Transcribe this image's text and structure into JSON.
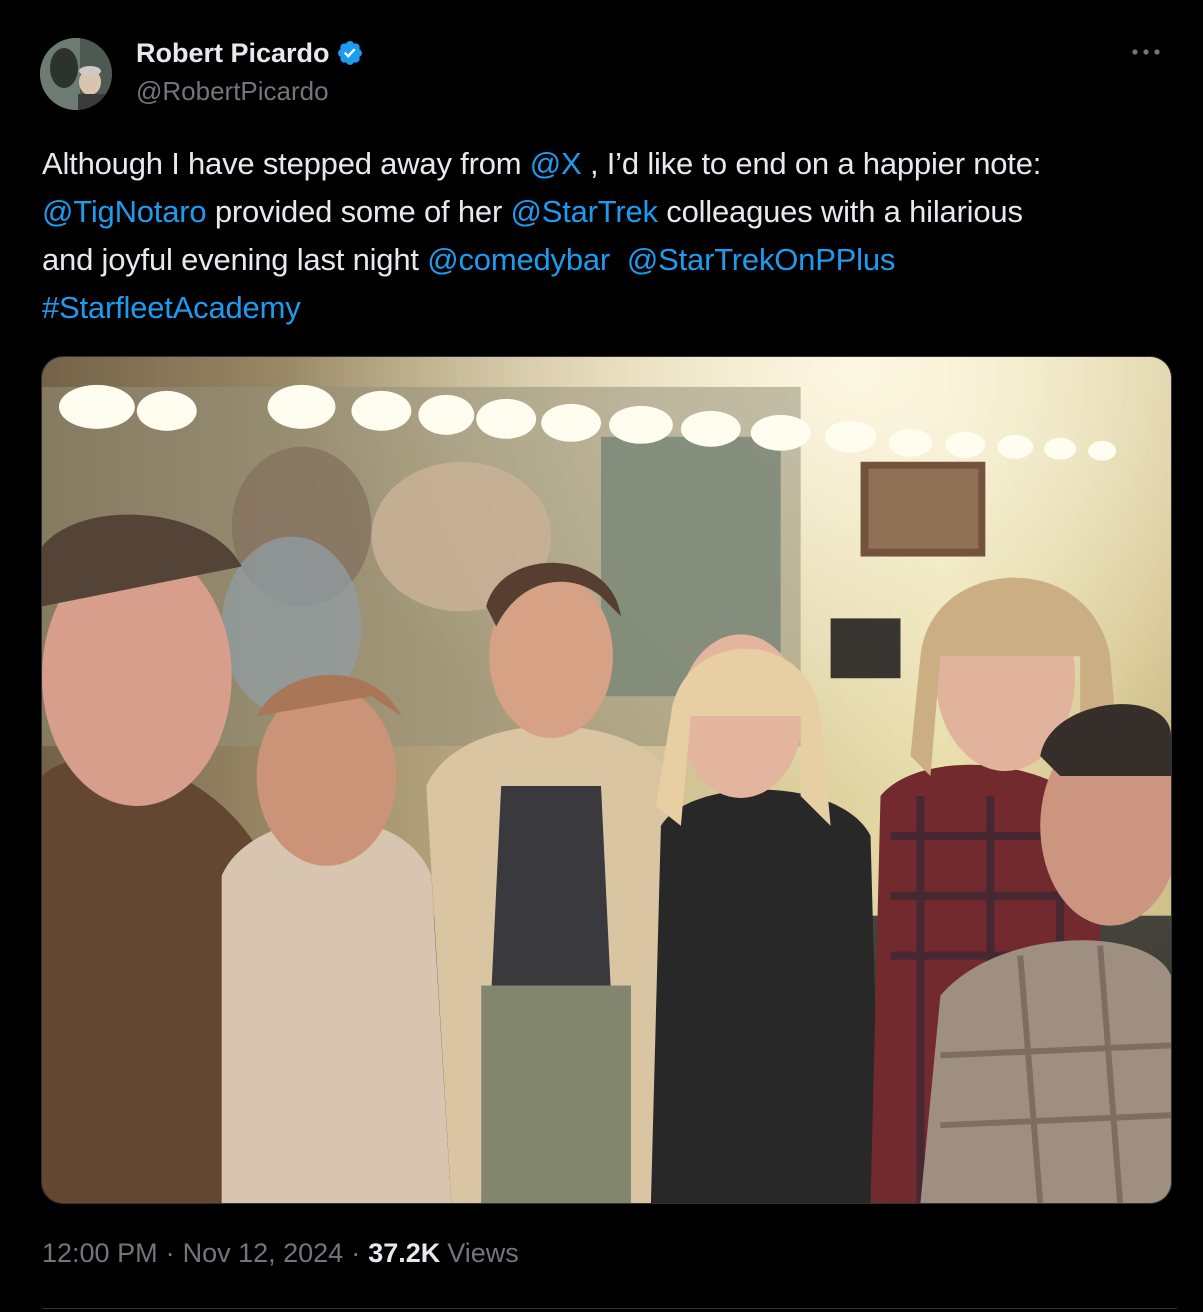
{
  "author": {
    "display_name": "Robert Picardo",
    "handle": "@RobertPicardo",
    "verified": true,
    "avatar_icon": "profile-photo"
  },
  "tweet": {
    "lines": [
      [
        {
          "text": "Although I have stepped away from ",
          "link": false
        },
        {
          "text": "@X",
          "link": true
        },
        {
          "text": " , I’d like to end on a happier note:",
          "link": false
        }
      ],
      [
        {
          "text": "@TigNotaro",
          "link": true
        },
        {
          "text": " provided some of her ",
          "link": false
        },
        {
          "text": "@StarTrek",
          "link": true
        },
        {
          "text": " colleagues with a hilarious",
          "link": false
        }
      ],
      [
        {
          "text": "and joyful evening last night ",
          "link": false
        },
        {
          "text": "@comedybar",
          "link": true
        },
        {
          "text": "  ",
          "link": false
        },
        {
          "text": "@StarTrekOnPPlus",
          "link": true
        }
      ],
      [
        {
          "text": "#StarfleetAcademy",
          "link": true
        }
      ]
    ]
  },
  "meta": {
    "time": "12:00 PM",
    "separator": "·",
    "date": "Nov 12, 2024",
    "views_count": "37.2K",
    "views_label": "Views"
  },
  "colors": {
    "background": "#000000",
    "text": "#e7e9ea",
    "secondary": "#71767b",
    "link": "#1d9bf0",
    "verified": "#1d9bf0"
  },
  "icons": {
    "more": "more-horizontal-icon",
    "verified": "verified-badge-icon"
  }
}
